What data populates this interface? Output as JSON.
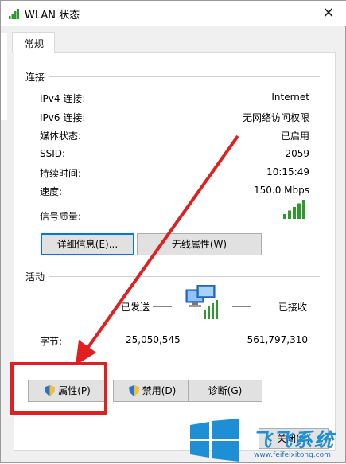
{
  "window": {
    "title": "WLAN 状态",
    "close_glyph": "✕"
  },
  "tabs": [
    {
      "label": "常规"
    }
  ],
  "connection": {
    "group_label": "连接",
    "rows": [
      {
        "label": "IPv4 连接:",
        "value": "Internet"
      },
      {
        "label": "IPv6 连接:",
        "value": "无网络访问权限"
      },
      {
        "label": "媒体状态:",
        "value": "已启用"
      },
      {
        "label": "SSID:",
        "value": "2059"
      },
      {
        "label": "持续时间:",
        "value": "10:15:49"
      },
      {
        "label": "速度:",
        "value": "150.0 Mbps"
      }
    ],
    "signal_label": "信号质量:",
    "signal_bars_filled": 5,
    "signal_bars_total": 5,
    "details_button": "详细信息(E)...",
    "wireless_props_button": "无线属性(W)"
  },
  "activity": {
    "group_label": "活动",
    "sent_label": "已发送",
    "received_label": "已接收",
    "bytes_label": "字节:",
    "bytes_sent": "25,050,545",
    "bytes_received": "561,797,310"
  },
  "actions": {
    "properties_button": "属性(P)",
    "disable_button": "禁用(D)",
    "diagnose_button": "诊断(G)",
    "close_button": "关闭(C)"
  },
  "watermark": {
    "text": "飞飞系统",
    "url": "www.feifeixitong.com"
  },
  "colors": {
    "accent": "#0078d7",
    "signal_green": "#2e9a2e",
    "annotation_red": "#e02020",
    "watermark_blue": "#1e8fd4"
  }
}
